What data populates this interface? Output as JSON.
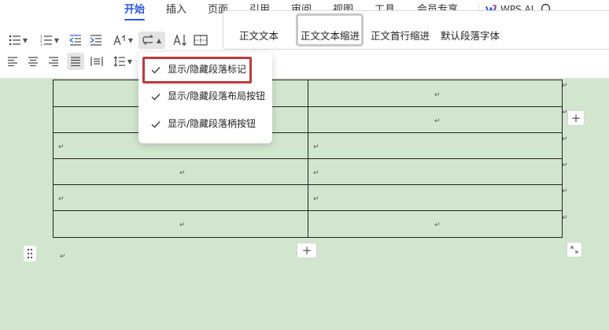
{
  "menu": {
    "tabs": [
      "开始",
      "插入",
      "页面",
      "引用",
      "审阅",
      "视图",
      "工具",
      "会员专享"
    ],
    "active_tab": "开始",
    "ai_label": "WPS AI"
  },
  "styles": {
    "items": [
      "正文文本",
      "正文文本缩进",
      "正文首行缩进",
      "默认段落字体"
    ],
    "selected": "正文文本缩进"
  },
  "dropdown": {
    "items": [
      {
        "label": "显示/隐藏段落标记",
        "checked": true,
        "highlighted": true
      },
      {
        "label": "显示/隐藏段落布局按钮",
        "checked": true,
        "highlighted": false
      },
      {
        "label": "显示/隐藏段落柄按钮",
        "checked": true,
        "highlighted": false
      }
    ]
  },
  "table": {
    "rows": 6,
    "cols": 2,
    "cell_mark": "↵",
    "add_symbol": "+"
  },
  "colors": {
    "accent": "#2a55e5",
    "highlight_border": "#c0393b",
    "document_bg": "#d2e6cf"
  }
}
